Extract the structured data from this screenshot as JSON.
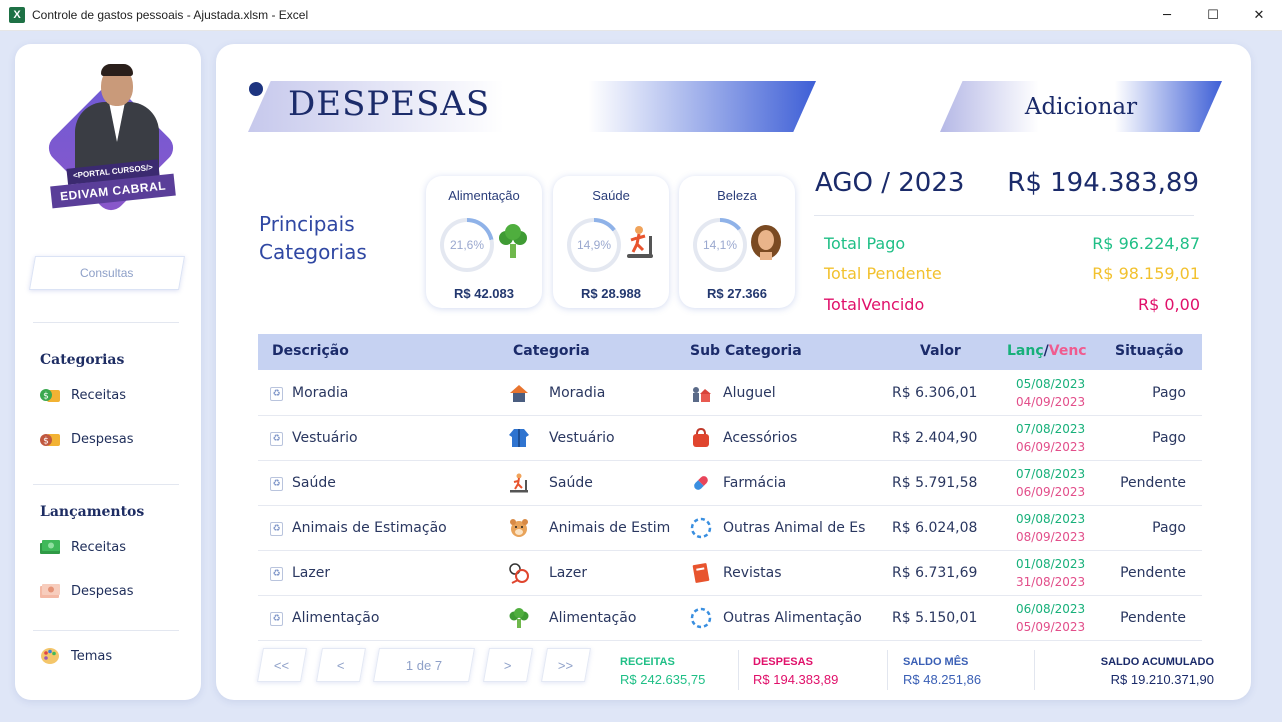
{
  "window": {
    "title": "Controle de gastos pessoais - Ajustada.xlsm - Excel",
    "icon": "X",
    "minimize": "─",
    "maximize": "☐",
    "close": "✕"
  },
  "sidebar": {
    "brand_tag": "<PORTAL CURSOS/>",
    "brand_name": "EDIVAM CABRAL",
    "consultas": "Consultas",
    "categorias_head": "Categorias",
    "categorias_items": [
      {
        "label": "Receitas",
        "icon": "money-coins-icon"
      },
      {
        "label": "Despesas",
        "icon": "money-bag-icon"
      }
    ],
    "lancamentos_head": "Lançamentos",
    "lancamentos_items": [
      {
        "label": "Receitas",
        "icon": "cash-stack-icon"
      },
      {
        "label": "Despesas",
        "icon": "bills-icon"
      }
    ],
    "temas": "Temas"
  },
  "header": {
    "title": "DESPESAS",
    "add_button": "Adicionar"
  },
  "principais": {
    "title_line1": "Principais",
    "title_line2": "Categorias",
    "cards": [
      {
        "name": "Alimentação",
        "percent": "21,6%",
        "value": "R$ 42.083",
        "fraction": 0.216,
        "icon": "broccoli-icon"
      },
      {
        "name": "Saúde",
        "percent": "14,9%",
        "value": "R$ 28.988",
        "fraction": 0.149,
        "icon": "treadmill-icon"
      },
      {
        "name": "Beleza",
        "percent": "14,1%",
        "value": "R$ 27.366",
        "fraction": 0.141,
        "icon": "woman-hair-icon"
      }
    ]
  },
  "summary": {
    "period": "AGO / 2023",
    "total": "R$ 194.383,89",
    "rows": [
      {
        "label": "Total Pago",
        "value": "R$ 96.224,87",
        "color": "#1fbf86"
      },
      {
        "label": "Total Pendente",
        "value": "R$ 98.159,01",
        "color": "#f2c12e"
      },
      {
        "label": "TotalVencido",
        "value": "R$ 0,00",
        "color": "#e0106a"
      }
    ]
  },
  "table": {
    "headers": {
      "descricao": "Descrição",
      "categoria": "Categoria",
      "subcategoria": "Sub Categoria",
      "valor": "Valor",
      "lanc": "Lanç",
      "slash": "/",
      "venc": "Venc",
      "situacao": "Situação"
    },
    "rows": [
      {
        "descricao": "Moradia",
        "categoria": "Moradia",
        "subcategoria": "Aluguel",
        "valor": "R$ 6.306,01",
        "lanc": "05/08/2023",
        "venc": "04/09/2023",
        "situacao": "Pago"
      },
      {
        "descricao": "Vestuário",
        "categoria": "Vestuário",
        "subcategoria": "Acessórios",
        "valor": "R$ 2.404,90",
        "lanc": "07/08/2023",
        "venc": "06/09/2023",
        "situacao": "Pago"
      },
      {
        "descricao": "Saúde",
        "categoria": "Saúde",
        "subcategoria": "Farmácia",
        "valor": "R$ 5.791,58",
        "lanc": "07/08/2023",
        "venc": "06/09/2023",
        "situacao": "Pendente"
      },
      {
        "descricao": "Animais de Estimação",
        "categoria": "Animais de Estim",
        "subcategoria": "Outras Animal de Es",
        "valor": "R$ 6.024,08",
        "lanc": "09/08/2023",
        "venc": "08/09/2023",
        "situacao": "Pago"
      },
      {
        "descricao": "Lazer",
        "categoria": "Lazer",
        "subcategoria": "Revistas",
        "valor": "R$ 6.731,69",
        "lanc": "01/08/2023",
        "venc": "31/08/2023",
        "situacao": "Pendente"
      },
      {
        "descricao": "Alimentação",
        "categoria": "Alimentação",
        "subcategoria": "Outras Alimentação",
        "valor": "R$ 5.150,01",
        "lanc": "06/08/2023",
        "venc": "05/09/2023",
        "situacao": "Pendente"
      }
    ]
  },
  "pagination": {
    "first": "<<",
    "prev": "<",
    "page": "1 de 7",
    "next": ">",
    "last": ">>"
  },
  "footer": {
    "receitas_label": "RECEITAS",
    "receitas_value": "R$ 242.635,75",
    "despesas_label": "DESPESAS",
    "despesas_value": "R$ 194.383,89",
    "saldo_mes_label": "SALDO MÊS",
    "saldo_mes_value": "R$ 48.251,86",
    "saldo_acum_label": "SALDO ACUMULADO",
    "saldo_acum_value": "R$ 19.210.371,90"
  },
  "colors": {
    "accent": "#1b2b6a",
    "header_row": "#c6d2f2",
    "pago": "#1fbf86",
    "pendente": "#f2c12e",
    "vencido": "#e0106a"
  }
}
